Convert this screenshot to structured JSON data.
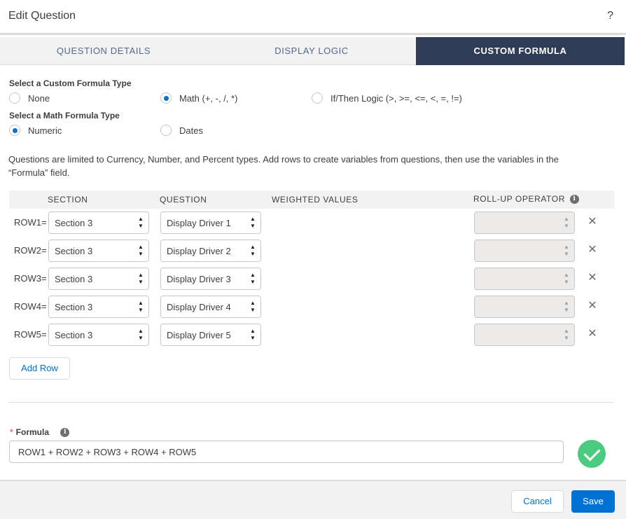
{
  "modal": {
    "title": "Edit Question",
    "help_label": "?"
  },
  "tabs": [
    {
      "label": "QUESTION DETAILS"
    },
    {
      "label": "DISPLAY LOGIC"
    },
    {
      "label": "CUSTOM FORMULA",
      "active": true
    }
  ],
  "formula_type": {
    "label": "Select a Custom Formula Type",
    "options": [
      {
        "label": "None",
        "selected": false
      },
      {
        "label": "Math (+, -, /, *)",
        "selected": true
      },
      {
        "label": "If/Then Logic (>, >=, <=, <, =, !=)",
        "selected": false
      }
    ]
  },
  "math_type": {
    "label": "Select a Math Formula Type",
    "options": [
      {
        "label": "Numeric",
        "selected": true
      },
      {
        "label": "Dates",
        "selected": false
      }
    ]
  },
  "description": "Questions are limited to Currency, Number, and Percent types. Add rows to create variables from questions, then use the variables in the “Formula” field.",
  "table": {
    "headers": {
      "section": "SECTION",
      "question": "QUESTION",
      "weighted": "WEIGHTED VALUES",
      "rollup": "ROLL-UP OPERATOR"
    },
    "rows": [
      {
        "label": "ROW1=",
        "section": "Section 3",
        "question": "Display Driver 1",
        "rollup": ""
      },
      {
        "label": "ROW2=",
        "section": "Section 3",
        "question": "Display Driver 2",
        "rollup": ""
      },
      {
        "label": "ROW3=",
        "section": "Section 3",
        "question": "Display Driver 3",
        "rollup": ""
      },
      {
        "label": "ROW4=",
        "section": "Section 3",
        "question": "Display Driver 4",
        "rollup": ""
      },
      {
        "label": "ROW5=",
        "section": "Section 3",
        "question": "Display Driver 5",
        "rollup": ""
      }
    ]
  },
  "add_row_label": "Add Row",
  "formula": {
    "label": "Formula",
    "required_mark": "*",
    "value": "ROW1 + ROW2 + ROW3 + ROW4 + ROW5",
    "valid": true
  },
  "footer": {
    "cancel_label": "Cancel",
    "save_label": "Save"
  },
  "colors": {
    "brand": "#0070d2",
    "active_tab": "#2e3d55",
    "success": "#4bca81",
    "required": "#c23934"
  }
}
